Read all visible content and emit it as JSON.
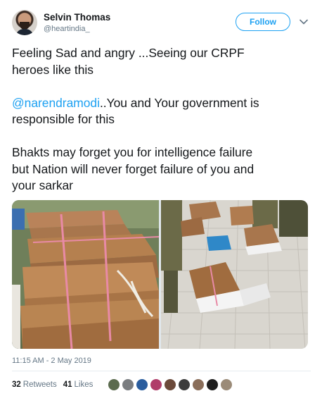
{
  "user": {
    "name": "Selvin Thomas",
    "handle": "@heartindia_"
  },
  "actions": {
    "follow_label": "Follow",
    "menu_icon": "chevron-down-icon"
  },
  "tweet": {
    "line1": "Feeling Sad and angry ...Seeing our CRPF",
    "line2": "heroes like this",
    "mention": "@narendramodi",
    "line3_rest": "..You and Your government is",
    "line4": "responsible for this",
    "line5": "Bhakts may forget you for intelligence failure",
    "line6": "but Nation will never forget failure of you and",
    "line7": "your sarkar"
  },
  "timestamp": "11:15 AM - 2 May 2019",
  "stats": {
    "retweets_count": "32",
    "retweets_label": "Retweets",
    "likes_count": "41",
    "likes_label": "Likes"
  },
  "colors": {
    "accent": "#1da1f2",
    "text": "#14171a",
    "muted": "#657786"
  },
  "liker_avatars": [
    "#5b6b4e",
    "#7a7d80",
    "#2a5d9e",
    "#b03d6a",
    "#6b4a3a",
    "#3c3c3c",
    "#8a6e5a",
    "#1f1f1f",
    "#9b8b78"
  ]
}
